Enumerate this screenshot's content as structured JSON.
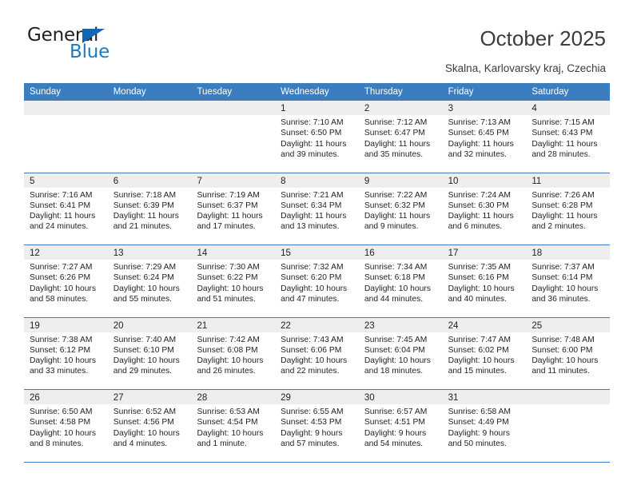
{
  "logo": {
    "word_dark": "General",
    "word_blue": "Blue",
    "triangle_color": "#1167b1",
    "blue_color": "#1a7ac4"
  },
  "header": {
    "title": "October 2025",
    "subtitle": "Skalna, Karlovarsky kraj, Czechia"
  },
  "colors": {
    "header_blue": "#3a7ebf",
    "daynum_strip": "#eeeeee",
    "text": "#231f20"
  },
  "weekdays": [
    "Sunday",
    "Monday",
    "Tuesday",
    "Wednesday",
    "Thursday",
    "Friday",
    "Saturday"
  ],
  "weeks": [
    [
      {
        "empty": true
      },
      {
        "empty": true
      },
      {
        "empty": true
      },
      {
        "day": "1",
        "sunrise": "Sunrise: 7:10 AM",
        "sunset": "Sunset: 6:50 PM",
        "daylight1": "Daylight: 11 hours",
        "daylight2": "and 39 minutes."
      },
      {
        "day": "2",
        "sunrise": "Sunrise: 7:12 AM",
        "sunset": "Sunset: 6:47 PM",
        "daylight1": "Daylight: 11 hours",
        "daylight2": "and 35 minutes."
      },
      {
        "day": "3",
        "sunrise": "Sunrise: 7:13 AM",
        "sunset": "Sunset: 6:45 PM",
        "daylight1": "Daylight: 11 hours",
        "daylight2": "and 32 minutes."
      },
      {
        "day": "4",
        "sunrise": "Sunrise: 7:15 AM",
        "sunset": "Sunset: 6:43 PM",
        "daylight1": "Daylight: 11 hours",
        "daylight2": "and 28 minutes."
      }
    ],
    [
      {
        "day": "5",
        "sunrise": "Sunrise: 7:16 AM",
        "sunset": "Sunset: 6:41 PM",
        "daylight1": "Daylight: 11 hours",
        "daylight2": "and 24 minutes."
      },
      {
        "day": "6",
        "sunrise": "Sunrise: 7:18 AM",
        "sunset": "Sunset: 6:39 PM",
        "daylight1": "Daylight: 11 hours",
        "daylight2": "and 21 minutes."
      },
      {
        "day": "7",
        "sunrise": "Sunrise: 7:19 AM",
        "sunset": "Sunset: 6:37 PM",
        "daylight1": "Daylight: 11 hours",
        "daylight2": "and 17 minutes."
      },
      {
        "day": "8",
        "sunrise": "Sunrise: 7:21 AM",
        "sunset": "Sunset: 6:34 PM",
        "daylight1": "Daylight: 11 hours",
        "daylight2": "and 13 minutes."
      },
      {
        "day": "9",
        "sunrise": "Sunrise: 7:22 AM",
        "sunset": "Sunset: 6:32 PM",
        "daylight1": "Daylight: 11 hours",
        "daylight2": "and 9 minutes."
      },
      {
        "day": "10",
        "sunrise": "Sunrise: 7:24 AM",
        "sunset": "Sunset: 6:30 PM",
        "daylight1": "Daylight: 11 hours",
        "daylight2": "and 6 minutes."
      },
      {
        "day": "11",
        "sunrise": "Sunrise: 7:26 AM",
        "sunset": "Sunset: 6:28 PM",
        "daylight1": "Daylight: 11 hours",
        "daylight2": "and 2 minutes."
      }
    ],
    [
      {
        "day": "12",
        "sunrise": "Sunrise: 7:27 AM",
        "sunset": "Sunset: 6:26 PM",
        "daylight1": "Daylight: 10 hours",
        "daylight2": "and 58 minutes."
      },
      {
        "day": "13",
        "sunrise": "Sunrise: 7:29 AM",
        "sunset": "Sunset: 6:24 PM",
        "daylight1": "Daylight: 10 hours",
        "daylight2": "and 55 minutes."
      },
      {
        "day": "14",
        "sunrise": "Sunrise: 7:30 AM",
        "sunset": "Sunset: 6:22 PM",
        "daylight1": "Daylight: 10 hours",
        "daylight2": "and 51 minutes."
      },
      {
        "day": "15",
        "sunrise": "Sunrise: 7:32 AM",
        "sunset": "Sunset: 6:20 PM",
        "daylight1": "Daylight: 10 hours",
        "daylight2": "and 47 minutes."
      },
      {
        "day": "16",
        "sunrise": "Sunrise: 7:34 AM",
        "sunset": "Sunset: 6:18 PM",
        "daylight1": "Daylight: 10 hours",
        "daylight2": "and 44 minutes."
      },
      {
        "day": "17",
        "sunrise": "Sunrise: 7:35 AM",
        "sunset": "Sunset: 6:16 PM",
        "daylight1": "Daylight: 10 hours",
        "daylight2": "and 40 minutes."
      },
      {
        "day": "18",
        "sunrise": "Sunrise: 7:37 AM",
        "sunset": "Sunset: 6:14 PM",
        "daylight1": "Daylight: 10 hours",
        "daylight2": "and 36 minutes."
      }
    ],
    [
      {
        "day": "19",
        "sunrise": "Sunrise: 7:38 AM",
        "sunset": "Sunset: 6:12 PM",
        "daylight1": "Daylight: 10 hours",
        "daylight2": "and 33 minutes."
      },
      {
        "day": "20",
        "sunrise": "Sunrise: 7:40 AM",
        "sunset": "Sunset: 6:10 PM",
        "daylight1": "Daylight: 10 hours",
        "daylight2": "and 29 minutes."
      },
      {
        "day": "21",
        "sunrise": "Sunrise: 7:42 AM",
        "sunset": "Sunset: 6:08 PM",
        "daylight1": "Daylight: 10 hours",
        "daylight2": "and 26 minutes."
      },
      {
        "day": "22",
        "sunrise": "Sunrise: 7:43 AM",
        "sunset": "Sunset: 6:06 PM",
        "daylight1": "Daylight: 10 hours",
        "daylight2": "and 22 minutes."
      },
      {
        "day": "23",
        "sunrise": "Sunrise: 7:45 AM",
        "sunset": "Sunset: 6:04 PM",
        "daylight1": "Daylight: 10 hours",
        "daylight2": "and 18 minutes."
      },
      {
        "day": "24",
        "sunrise": "Sunrise: 7:47 AM",
        "sunset": "Sunset: 6:02 PM",
        "daylight1": "Daylight: 10 hours",
        "daylight2": "and 15 minutes."
      },
      {
        "day": "25",
        "sunrise": "Sunrise: 7:48 AM",
        "sunset": "Sunset: 6:00 PM",
        "daylight1": "Daylight: 10 hours",
        "daylight2": "and 11 minutes."
      }
    ],
    [
      {
        "day": "26",
        "sunrise": "Sunrise: 6:50 AM",
        "sunset": "Sunset: 4:58 PM",
        "daylight1": "Daylight: 10 hours",
        "daylight2": "and 8 minutes."
      },
      {
        "day": "27",
        "sunrise": "Sunrise: 6:52 AM",
        "sunset": "Sunset: 4:56 PM",
        "daylight1": "Daylight: 10 hours",
        "daylight2": "and 4 minutes."
      },
      {
        "day": "28",
        "sunrise": "Sunrise: 6:53 AM",
        "sunset": "Sunset: 4:54 PM",
        "daylight1": "Daylight: 10 hours",
        "daylight2": "and 1 minute."
      },
      {
        "day": "29",
        "sunrise": "Sunrise: 6:55 AM",
        "sunset": "Sunset: 4:53 PM",
        "daylight1": "Daylight: 9 hours",
        "daylight2": "and 57 minutes."
      },
      {
        "day": "30",
        "sunrise": "Sunrise: 6:57 AM",
        "sunset": "Sunset: 4:51 PM",
        "daylight1": "Daylight: 9 hours",
        "daylight2": "and 54 minutes."
      },
      {
        "day": "31",
        "sunrise": "Sunrise: 6:58 AM",
        "sunset": "Sunset: 4:49 PM",
        "daylight1": "Daylight: 9 hours",
        "daylight2": "and 50 minutes."
      },
      {
        "empty": true
      }
    ]
  ]
}
